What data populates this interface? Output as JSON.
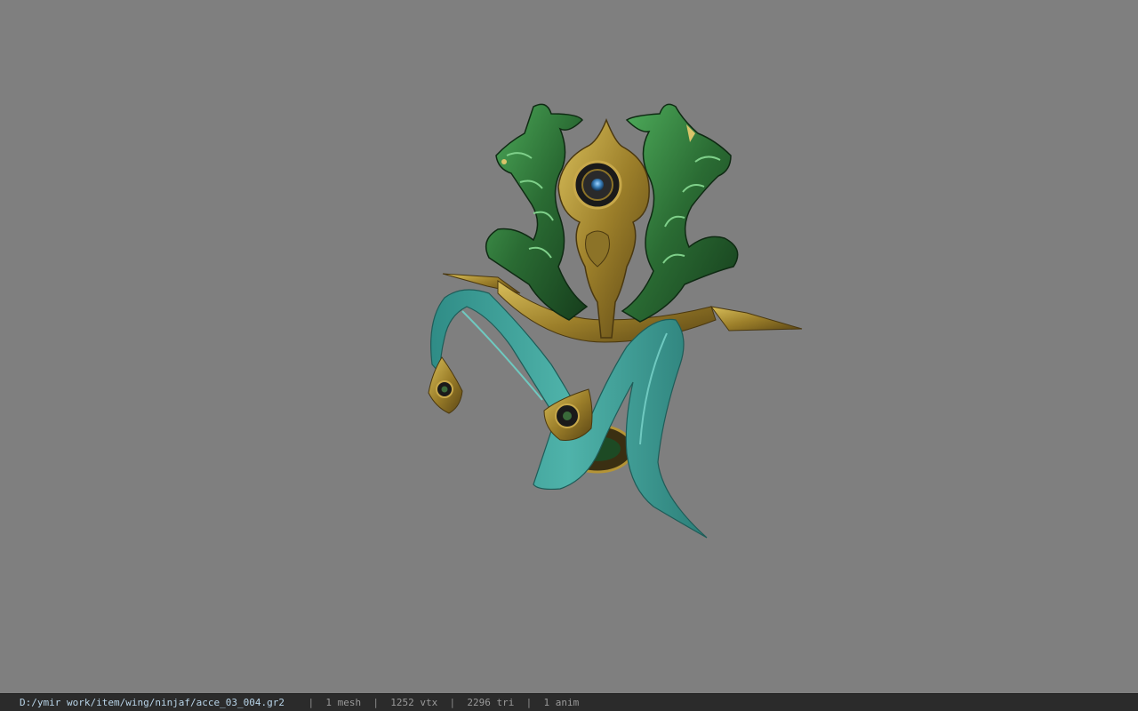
{
  "viewer": {
    "background_color": "#7f7f7f",
    "model_description_colors": {
      "jade": "#2f7a3a",
      "gold": "#a68a2e",
      "ribbon": "#3f9f98",
      "gem": "#3a7fb8"
    }
  },
  "statusbar": {
    "file_path": "D:/ymir work/item/wing/ninjaf/acce_03_004.gr2",
    "separator": "|",
    "mesh_count": "1 mesh",
    "vertex_count": "1252 vtx",
    "triangle_count": "2296 tri",
    "anim_count": "1 anim"
  }
}
